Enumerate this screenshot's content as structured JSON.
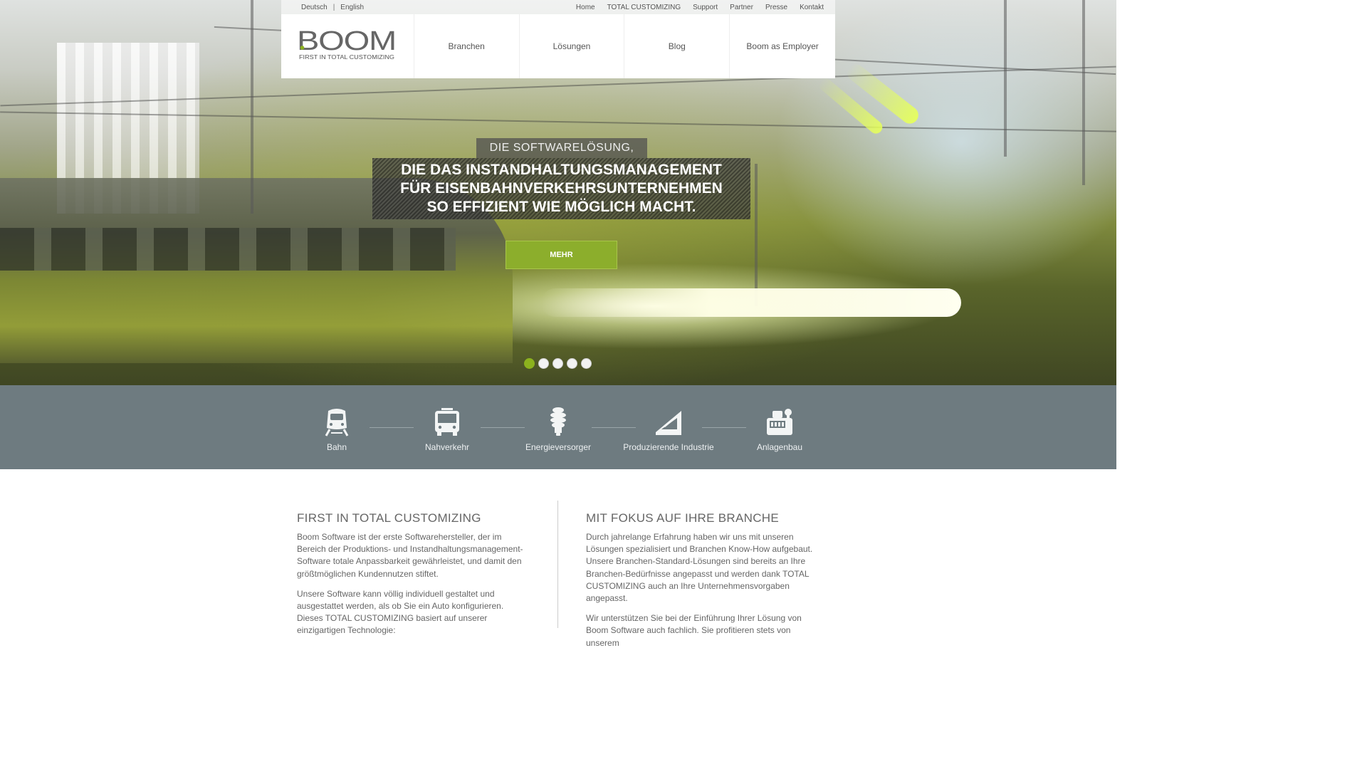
{
  "topbar": {
    "languages": [
      "Deutsch",
      "English"
    ],
    "language_separator": "|",
    "links": [
      "Home",
      "TOTAL CUSTOMIZING",
      "Support",
      "Partner",
      "Presse",
      "Kontakt"
    ]
  },
  "header": {
    "logo_text": "BOOM",
    "logo_tagline": "FIRST IN TOTAL CUSTOMIZING",
    "nav": [
      "Branchen",
      "Lösungen",
      "Blog",
      "Boom as Employer"
    ]
  },
  "slider": {
    "kicker": "DIE SOFTWARELÖSUNG,",
    "headline_lines": [
      "DIE DAS INSTANDHALTUNGSMANAGEMENT",
      "FÜR EISENBAHNVERKEHRSUNTERNEHMEN",
      "SO EFFIZIENT WIE MÖGLICH MACHT."
    ],
    "button_label": "MEHR",
    "dots_count": 5,
    "active_dot": 1
  },
  "industries": [
    {
      "label": "Bahn",
      "icon": "train-icon"
    },
    {
      "label": "Nahverkehr",
      "icon": "bus-icon"
    },
    {
      "label": "Energieversorger",
      "icon": "lightbulb-icon"
    },
    {
      "label": "Produzierende Industrie",
      "icon": "factory-icon"
    },
    {
      "label": "Anlagenbau",
      "icon": "machine-icon"
    }
  ],
  "content": {
    "left": {
      "title": "FIRST IN TOTAL CUSTOMIZING",
      "paragraphs": [
        "Boom Software ist der erste Softwarehersteller, der im Bereich der Produktions- und Instandhaltungsmanagement-Software totale Anpassbarkeit gewährleistet, und damit den größtmöglichen Kundennutzen stiftet.",
        "Unsere Software kann völlig individuell gestaltet und ausgestattet werden, als ob Sie ein Auto konfigurieren. Dieses TOTAL CUSTOMIZING basiert auf unserer einzigartigen Technologie:"
      ]
    },
    "right": {
      "title": "MIT FOKUS AUF IHRE BRANCHE",
      "paragraphs": [
        "Durch jahrelange Erfahrung haben wir uns mit unseren Lösungen spezialisiert und Branchen Know-How aufgebaut. Unsere Branchen-Standard-Lösungen sind bereits an Ihre Branchen-Bedürfnisse angepasst und werden dank TOTAL CUSTOMIZING auch an Ihre Unternehmensvorgaben angepasst.",
        "Wir unterstützen Sie bei der Einführung Ihrer Lösung von Boom Software auch fachlich. Sie profitieren stets von unserem"
      ]
    }
  },
  "colors": {
    "brand_green": "#8cb21e",
    "industry_bar": "#6e7b80"
  }
}
